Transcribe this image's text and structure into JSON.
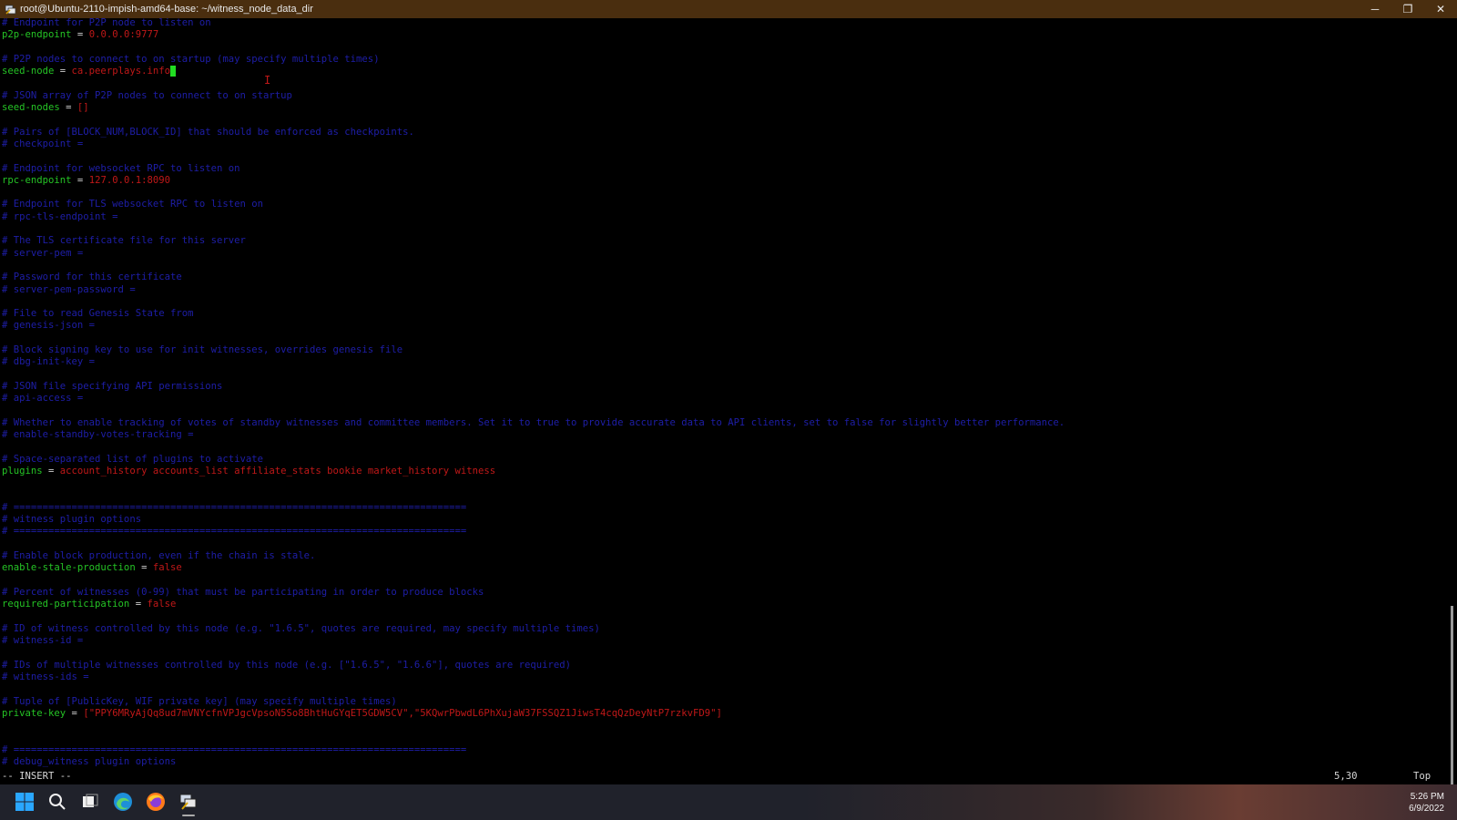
{
  "window": {
    "title": "root@Ubuntu-2110-impish-amd64-base: ~/witness_node_data_dir",
    "minimize": "─",
    "restore": "❐",
    "close": "✕"
  },
  "terminal": {
    "lines": [
      [
        {
          "t": "# Endpoint for P2P node to listen on",
          "c": "c"
        }
      ],
      [
        {
          "t": "p2p-endpoint",
          "c": "k"
        },
        {
          "t": " = ",
          "c": "o"
        },
        {
          "t": "0.0.0.0:9777",
          "c": "v"
        }
      ],
      [],
      [
        {
          "t": "# P2P nodes to connect to on startup (may specify multiple times)",
          "c": "c"
        }
      ],
      [
        {
          "t": "seed-node",
          "c": "k"
        },
        {
          "t": " = ",
          "c": "o"
        },
        {
          "t": "ca.peerplays.info",
          "c": "v"
        },
        {
          "t": " ",
          "c": "cursor"
        }
      ],
      [],
      [
        {
          "t": "# JSON array of P2P nodes to connect to on startup",
          "c": "c"
        }
      ],
      [
        {
          "t": "seed-nodes",
          "c": "k"
        },
        {
          "t": " = ",
          "c": "o"
        },
        {
          "t": "[]",
          "c": "v"
        }
      ],
      [],
      [
        {
          "t": "# Pairs of [BLOCK_NUM,BLOCK_ID] that should be enforced as checkpoints.",
          "c": "c"
        }
      ],
      [
        {
          "t": "# checkpoint =",
          "c": "c"
        }
      ],
      [],
      [
        {
          "t": "# Endpoint for websocket RPC to listen on",
          "c": "c"
        }
      ],
      [
        {
          "t": "rpc-endpoint",
          "c": "k"
        },
        {
          "t": " = ",
          "c": "o"
        },
        {
          "t": "127.0.0.1:8090",
          "c": "v"
        }
      ],
      [],
      [
        {
          "t": "# Endpoint for TLS websocket RPC to listen on",
          "c": "c"
        }
      ],
      [
        {
          "t": "# rpc-tls-endpoint =",
          "c": "c"
        }
      ],
      [],
      [
        {
          "t": "# The TLS certificate file for this server",
          "c": "c"
        }
      ],
      [
        {
          "t": "# server-pem =",
          "c": "c"
        }
      ],
      [],
      [
        {
          "t": "# Password for this certificate",
          "c": "c"
        }
      ],
      [
        {
          "t": "# server-pem-password =",
          "c": "c"
        }
      ],
      [],
      [
        {
          "t": "# File to read Genesis State from",
          "c": "c"
        }
      ],
      [
        {
          "t": "# genesis-json =",
          "c": "c"
        }
      ],
      [],
      [
        {
          "t": "# Block signing key to use for init witnesses, overrides genesis file",
          "c": "c"
        }
      ],
      [
        {
          "t": "# dbg-init-key =",
          "c": "c"
        }
      ],
      [],
      [
        {
          "t": "# JSON file specifying API permissions",
          "c": "c"
        }
      ],
      [
        {
          "t": "# api-access =",
          "c": "c"
        }
      ],
      [],
      [
        {
          "t": "# Whether to enable tracking of votes of standby witnesses and committee members. Set it to true to provide accurate data to API clients, set to false for slightly better performance.",
          "c": "c"
        }
      ],
      [
        {
          "t": "# enable-standby-votes-tracking =",
          "c": "c"
        }
      ],
      [],
      [
        {
          "t": "# Space-separated list of plugins to activate",
          "c": "c"
        }
      ],
      [
        {
          "t": "plugins",
          "c": "k"
        },
        {
          "t": " = ",
          "c": "o"
        },
        {
          "t": "account_history accounts_list affiliate_stats bookie market_history witness",
          "c": "v"
        }
      ],
      [],
      [],
      [
        {
          "t": "# ==============================================================================",
          "c": "c"
        }
      ],
      [
        {
          "t": "# witness plugin options",
          "c": "c"
        }
      ],
      [
        {
          "t": "# ==============================================================================",
          "c": "c"
        }
      ],
      [],
      [
        {
          "t": "# Enable block production, even if the chain is stale.",
          "c": "c"
        }
      ],
      [
        {
          "t": "enable-stale-production",
          "c": "k"
        },
        {
          "t": " = ",
          "c": "o"
        },
        {
          "t": "false",
          "c": "v"
        }
      ],
      [],
      [
        {
          "t": "# Percent of witnesses (0-99) that must be participating in order to produce blocks",
          "c": "c"
        }
      ],
      [
        {
          "t": "required-participation",
          "c": "k"
        },
        {
          "t": " = ",
          "c": "o"
        },
        {
          "t": "false",
          "c": "v"
        }
      ],
      [],
      [
        {
          "t": "# ID of witness controlled by this node (e.g. \"1.6.5\", quotes are required, may specify multiple times)",
          "c": "c"
        }
      ],
      [
        {
          "t": "# witness-id =",
          "c": "c"
        }
      ],
      [],
      [
        {
          "t": "# IDs of multiple witnesses controlled by this node (e.g. [\"1.6.5\", \"1.6.6\"], quotes are required)",
          "c": "c"
        }
      ],
      [
        {
          "t": "# witness-ids =",
          "c": "c"
        }
      ],
      [],
      [
        {
          "t": "# Tuple of [PublicKey, WIF private key] (may specify multiple times)",
          "c": "c"
        }
      ],
      [
        {
          "t": "private-key",
          "c": "k"
        },
        {
          "t": " = ",
          "c": "o"
        },
        {
          "t": "[\"PPY6MRyAjQq8ud7mVNYcfnVPJgcVpsoN5So8BhtHuGYqET5GDW5CV\",\"5KQwrPbwdL6PhXujaW37FSSQZ1JiwsT4cqQzDeyNtP7rzkvFD9\"]",
          "c": "v"
        }
      ],
      [],
      [],
      [
        {
          "t": "# ==============================================================================",
          "c": "c"
        }
      ],
      [
        {
          "t": "# debug_witness plugin options",
          "c": "c"
        }
      ]
    ]
  },
  "statusline": {
    "mode": "-- INSERT --",
    "position": "5,30",
    "scroll": "Top"
  },
  "taskbar": {
    "icons": [
      "windows-start-icon",
      "search-icon",
      "task-view-icon",
      "edge-browser-icon",
      "firefox-icon",
      "putty-icon"
    ],
    "time": "5:26 PM",
    "date": "6/9/2022"
  },
  "colors": {
    "comment": "#1e1ea8",
    "key": "#25c325",
    "value": "#c01818",
    "cursor": "#22dd22",
    "titlebar": "#4a2e0f"
  }
}
